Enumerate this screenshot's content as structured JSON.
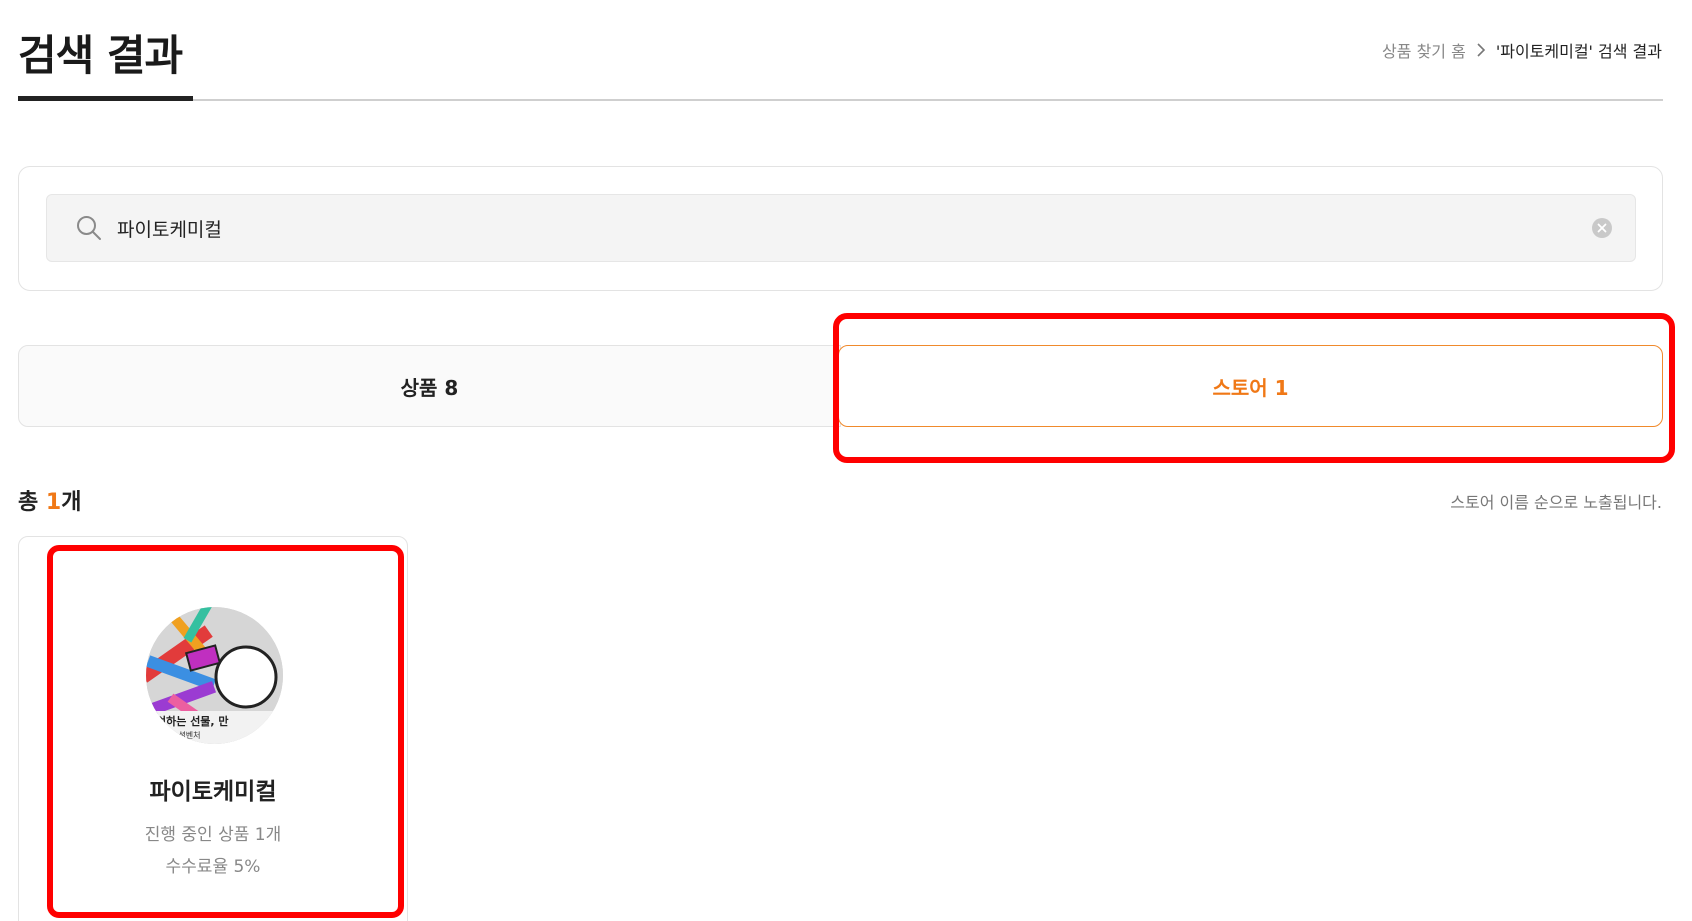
{
  "header": {
    "title": "검색 결과",
    "breadcrumb": {
      "home": "상품 찾기 홈",
      "current": "'파이토케미컬' 검색 결과"
    }
  },
  "search": {
    "value": "파이토케미컬"
  },
  "tabs": [
    {
      "label": "상품 8",
      "active": false
    },
    {
      "label": "스토어 1",
      "active": true
    }
  ],
  "results": {
    "count_prefix": "총 ",
    "count": "1",
    "count_suffix": "개",
    "sort_note": "스토어 이름 순으로 노출됩니다."
  },
  "stores": [
    {
      "name": "파이토케미컬",
      "active_products": "진행 중인 상품 1개",
      "fee": "수수료율 5%"
    }
  ],
  "colors": {
    "accent": "#f07816",
    "highlight": "#ff0000",
    "text": "#222222",
    "muted": "#888888"
  }
}
